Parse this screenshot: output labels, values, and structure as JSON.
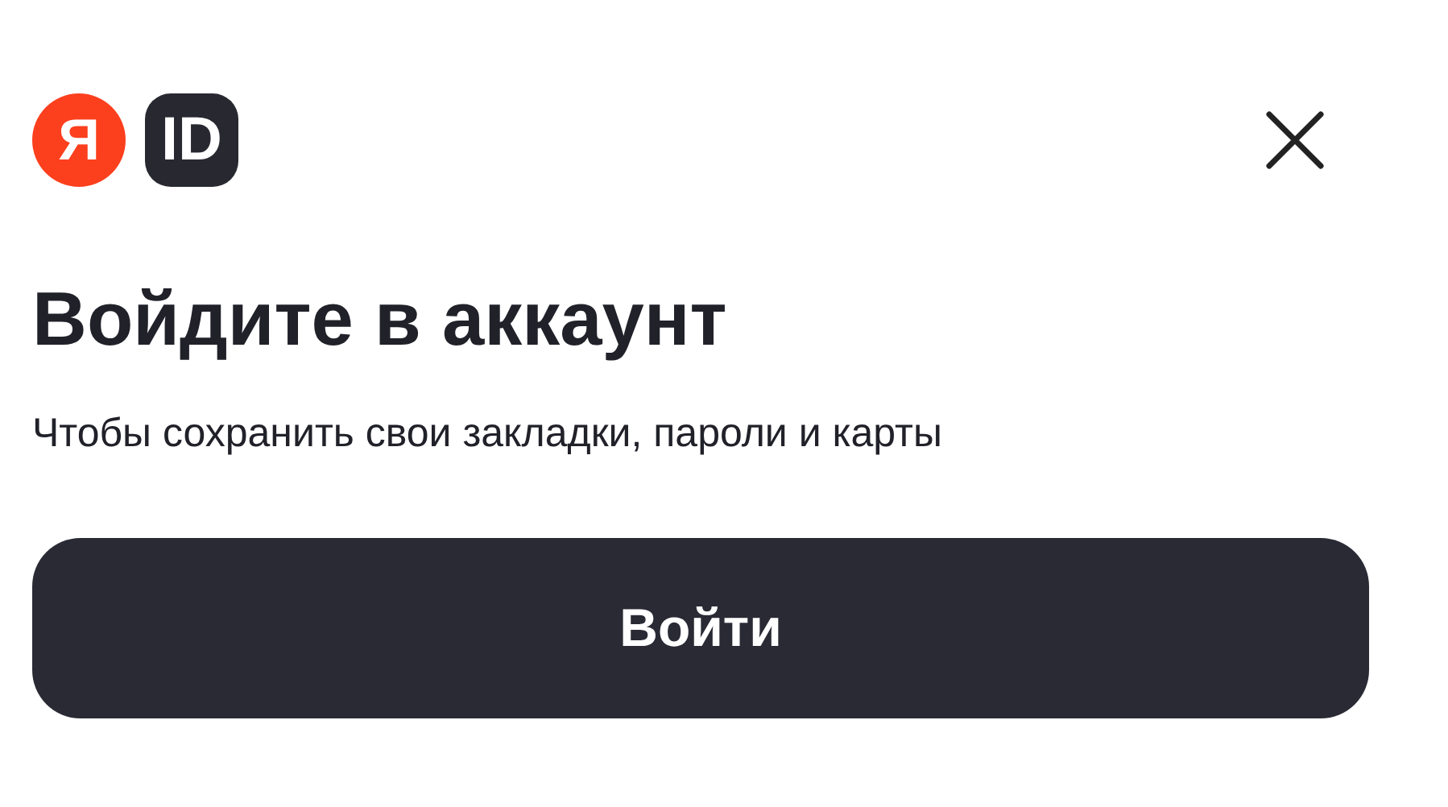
{
  "logo": {
    "letter": "Я",
    "mark": "ID"
  },
  "title": "Войдите в аккаунт",
  "subtitle": "Чтобы сохранить свои закладки, пароли и карты",
  "button": "Войти"
}
